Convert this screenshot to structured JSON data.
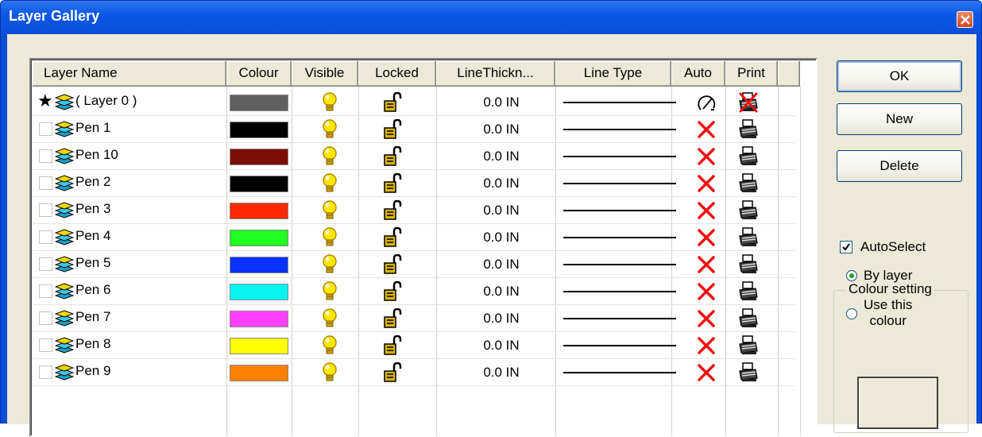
{
  "window": {
    "title": "Layer Gallery"
  },
  "columns": [
    "Layer Name",
    "Colour",
    "Visible",
    "Locked",
    "LineThickn...",
    "Line Type",
    "Auto",
    "Print"
  ],
  "layers": [
    {
      "name": "( Layer 0 )",
      "colour": "#606060",
      "thickness": "0.0 IN",
      "current": true
    },
    {
      "name": "Pen 1",
      "colour": "#000000",
      "thickness": "0.0 IN"
    },
    {
      "name": "Pen 10",
      "colour": "#7b0e00",
      "thickness": "0.0 IN"
    },
    {
      "name": "Pen 2",
      "colour": "#000000",
      "thickness": "0.0 IN"
    },
    {
      "name": "Pen 3",
      "colour": "#ff2a00",
      "thickness": "0.0 IN"
    },
    {
      "name": "Pen 4",
      "colour": "#20ff20",
      "thickness": "0.0 IN"
    },
    {
      "name": "Pen 5",
      "colour": "#0a32ff",
      "thickness": "0.0 IN"
    },
    {
      "name": "Pen 6",
      "colour": "#08f4f4",
      "thickness": "0.0 IN"
    },
    {
      "name": "Pen 7",
      "colour": "#ff40ff",
      "thickness": "0.0 IN"
    },
    {
      "name": "Pen 8",
      "colour": "#ffff00",
      "thickness": "0.0 IN"
    },
    {
      "name": "Pen 9",
      "colour": "#ff8000",
      "thickness": "0.0 IN"
    }
  ],
  "buttons": {
    "ok": "OK",
    "new": "New",
    "delete": "Delete"
  },
  "auto_select": {
    "label": "AutoSelect",
    "checked": true
  },
  "colour_setting": {
    "title": "Colour setting",
    "by_layer": "By layer",
    "use_this_line1": "Use this",
    "use_this_line2": "colour",
    "selected": "by_layer"
  },
  "icons": {
    "visible": "lightbulb-icon",
    "locked": "unlocked-padlock-icon",
    "auto_first": "pen-icon",
    "auto_rest": "red-x-icon",
    "print_first": "printer-disabled-icon",
    "print_rest": "printer-icon",
    "layer": "layer-stack-icon"
  }
}
